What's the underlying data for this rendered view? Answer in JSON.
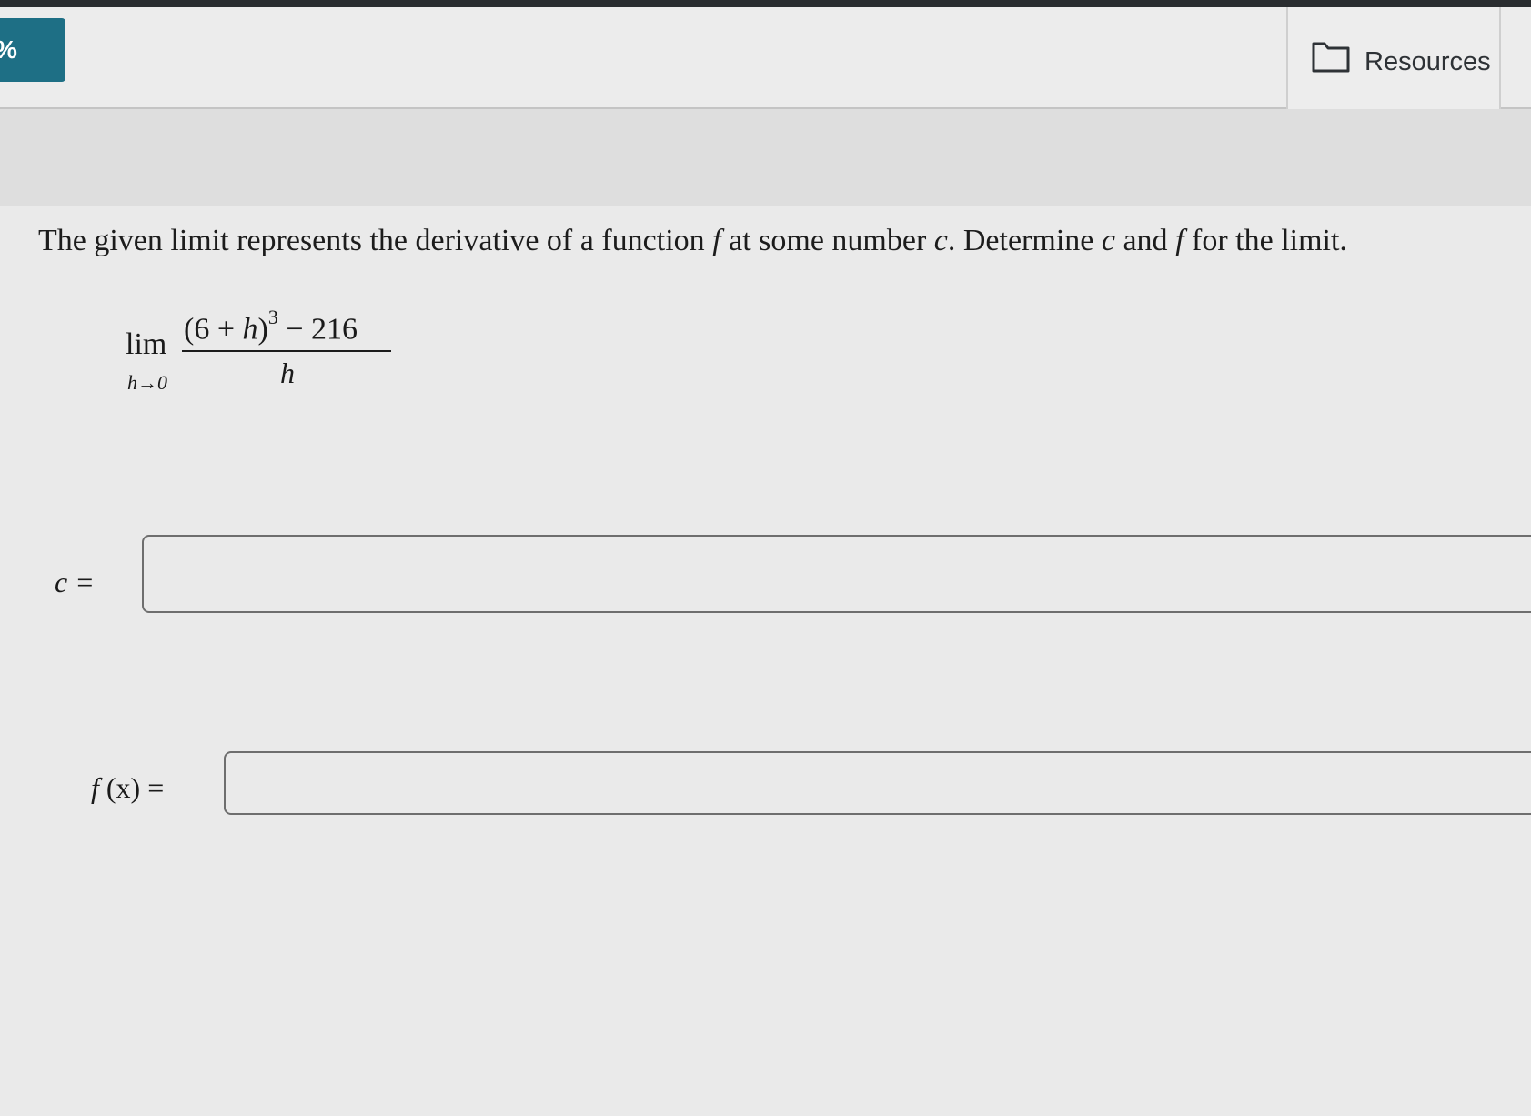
{
  "header": {
    "score_badge": "%",
    "resources_label": "Resources",
    "resources_icon": "folder-icon"
  },
  "question": {
    "part1": "The given limit represents the derivative of a function ",
    "f1": "f",
    "part2": " at some number ",
    "c1": "c",
    "part3": ". Determine ",
    "c2": "c",
    "part4": " and ",
    "f2": "f",
    "part5": " for the limit."
  },
  "limit": {
    "lim": "lim",
    "sub": "h→0",
    "num_open": "(6 + ",
    "num_h": "h",
    "num_close": ")",
    "num_exp": "3",
    "num_rest": " − 216",
    "denominator": "h"
  },
  "answers": {
    "c_label": "c =",
    "c_value": "",
    "f_label_f": "f",
    "f_label_rest": " (x) =",
    "f_value": ""
  }
}
